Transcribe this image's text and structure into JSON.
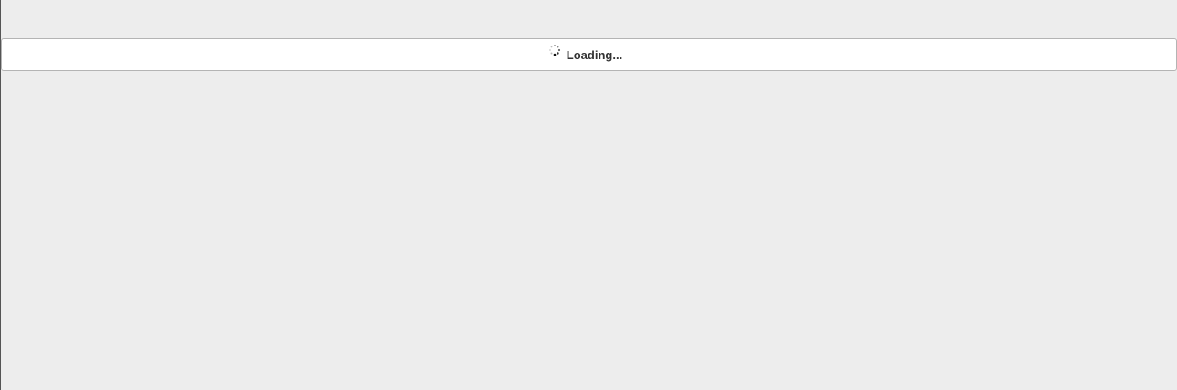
{
  "loading": {
    "label": "Loading...",
    "icon": "spinner-icon"
  }
}
